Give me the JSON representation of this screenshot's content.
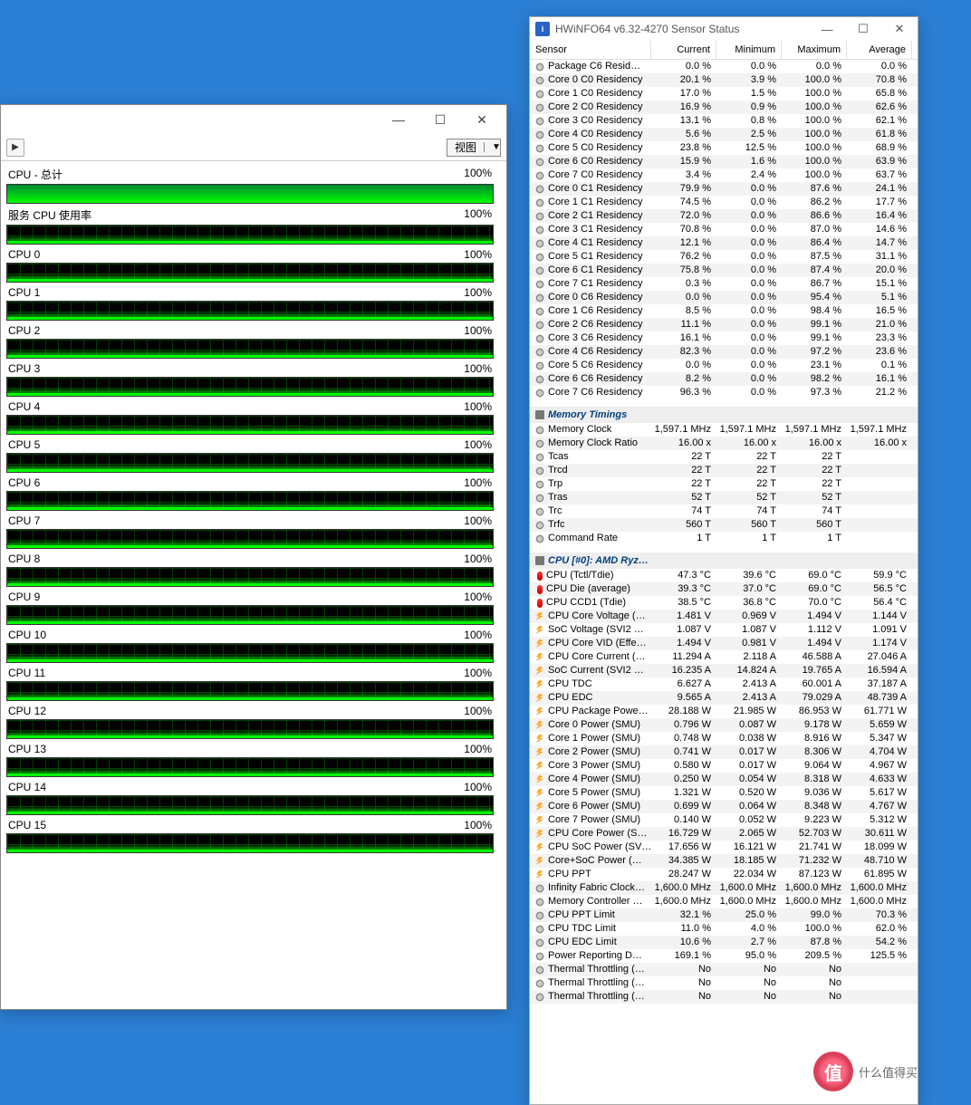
{
  "cpu_window": {
    "view_label": "视图",
    "min_btn": "—",
    "max_btn": "☐",
    "close_btn": "✕",
    "rows": [
      {
        "label": "CPU - 总计",
        "pct": "100%",
        "full": true
      },
      {
        "label": "服务 CPU 使用率",
        "pct": "100%",
        "full": false
      },
      {
        "label": "CPU 0",
        "pct": "100%",
        "full": false
      },
      {
        "label": "CPU 1",
        "pct": "100%",
        "full": false
      },
      {
        "label": "CPU 2",
        "pct": "100%",
        "full": false
      },
      {
        "label": "CPU 3",
        "pct": "100%",
        "full": false
      },
      {
        "label": "CPU 4",
        "pct": "100%",
        "full": false
      },
      {
        "label": "CPU 5",
        "pct": "100%",
        "full": false
      },
      {
        "label": "CPU 6",
        "pct": "100%",
        "full": false
      },
      {
        "label": "CPU 7",
        "pct": "100%",
        "full": false
      },
      {
        "label": "CPU 8",
        "pct": "100%",
        "full": false
      },
      {
        "label": "CPU 9",
        "pct": "100%",
        "full": false
      },
      {
        "label": "CPU 10",
        "pct": "100%",
        "full": false
      },
      {
        "label": "CPU 11",
        "pct": "100%",
        "full": false
      },
      {
        "label": "CPU 12",
        "pct": "100%",
        "full": false
      },
      {
        "label": "CPU 13",
        "pct": "100%",
        "full": false
      },
      {
        "label": "CPU 14",
        "pct": "100%",
        "full": false
      },
      {
        "label": "CPU 15",
        "pct": "100%",
        "full": false
      }
    ]
  },
  "hwinfo": {
    "title": "HWiNFO64 v6.32-4270 Sensor Status",
    "min_btn": "—",
    "max_btn": "☐",
    "close_btn": "✕",
    "columns": {
      "sensor": "Sensor",
      "cur": "Current",
      "min": "Minimum",
      "max": "Maximum",
      "avg": "Average"
    },
    "sections": [
      {
        "title": null,
        "rows": [
          {
            "ico": "clock",
            "name": "Package C6 Resid…",
            "cur": "0.0 %",
            "min": "0.0 %",
            "max": "0.0 %",
            "avg": "0.0 %"
          },
          {
            "ico": "clock",
            "name": "Core 0 C0 Residency",
            "cur": "20.1 %",
            "min": "3.9 %",
            "max": "100.0 %",
            "avg": "70.8 %"
          },
          {
            "ico": "clock",
            "name": "Core 1 C0 Residency",
            "cur": "17.0 %",
            "min": "1.5 %",
            "max": "100.0 %",
            "avg": "65.8 %"
          },
          {
            "ico": "clock",
            "name": "Core 2 C0 Residency",
            "cur": "16.9 %",
            "min": "0.9 %",
            "max": "100.0 %",
            "avg": "62.6 %"
          },
          {
            "ico": "clock",
            "name": "Core 3 C0 Residency",
            "cur": "13.1 %",
            "min": "0.8 %",
            "max": "100.0 %",
            "avg": "62.1 %"
          },
          {
            "ico": "clock",
            "name": "Core 4 C0 Residency",
            "cur": "5.6 %",
            "min": "2.5 %",
            "max": "100.0 %",
            "avg": "61.8 %"
          },
          {
            "ico": "clock",
            "name": "Core 5 C0 Residency",
            "cur": "23.8 %",
            "min": "12.5 %",
            "max": "100.0 %",
            "avg": "68.9 %"
          },
          {
            "ico": "clock",
            "name": "Core 6 C0 Residency",
            "cur": "15.9 %",
            "min": "1.6 %",
            "max": "100.0 %",
            "avg": "63.9 %"
          },
          {
            "ico": "clock",
            "name": "Core 7 C0 Residency",
            "cur": "3.4 %",
            "min": "2.4 %",
            "max": "100.0 %",
            "avg": "63.7 %"
          },
          {
            "ico": "clock",
            "name": "Core 0 C1 Residency",
            "cur": "79.9 %",
            "min": "0.0 %",
            "max": "87.6 %",
            "avg": "24.1 %"
          },
          {
            "ico": "clock",
            "name": "Core 1 C1 Residency",
            "cur": "74.5 %",
            "min": "0.0 %",
            "max": "86.2 %",
            "avg": "17.7 %"
          },
          {
            "ico": "clock",
            "name": "Core 2 C1 Residency",
            "cur": "72.0 %",
            "min": "0.0 %",
            "max": "86.6 %",
            "avg": "16.4 %"
          },
          {
            "ico": "clock",
            "name": "Core 3 C1 Residency",
            "cur": "70.8 %",
            "min": "0.0 %",
            "max": "87.0 %",
            "avg": "14.6 %"
          },
          {
            "ico": "clock",
            "name": "Core 4 C1 Residency",
            "cur": "12.1 %",
            "min": "0.0 %",
            "max": "86.4 %",
            "avg": "14.7 %"
          },
          {
            "ico": "clock",
            "name": "Core 5 C1 Residency",
            "cur": "76.2 %",
            "min": "0.0 %",
            "max": "87.5 %",
            "avg": "31.1 %"
          },
          {
            "ico": "clock",
            "name": "Core 6 C1 Residency",
            "cur": "75.8 %",
            "min": "0.0 %",
            "max": "87.4 %",
            "avg": "20.0 %"
          },
          {
            "ico": "clock",
            "name": "Core 7 C1 Residency",
            "cur": "0.3 %",
            "min": "0.0 %",
            "max": "86.7 %",
            "avg": "15.1 %"
          },
          {
            "ico": "clock",
            "name": "Core 0 C6 Residency",
            "cur": "0.0 %",
            "min": "0.0 %",
            "max": "95.4 %",
            "avg": "5.1 %"
          },
          {
            "ico": "clock",
            "name": "Core 1 C6 Residency",
            "cur": "8.5 %",
            "min": "0.0 %",
            "max": "98.4 %",
            "avg": "16.5 %"
          },
          {
            "ico": "clock",
            "name": "Core 2 C6 Residency",
            "cur": "11.1 %",
            "min": "0.0 %",
            "max": "99.1 %",
            "avg": "21.0 %"
          },
          {
            "ico": "clock",
            "name": "Core 3 C6 Residency",
            "cur": "16.1 %",
            "min": "0.0 %",
            "max": "99.1 %",
            "avg": "23.3 %"
          },
          {
            "ico": "clock",
            "name": "Core 4 C6 Residency",
            "cur": "82.3 %",
            "min": "0.0 %",
            "max": "97.2 %",
            "avg": "23.6 %"
          },
          {
            "ico": "clock",
            "name": "Core 5 C6 Residency",
            "cur": "0.0 %",
            "min": "0.0 %",
            "max": "23.1 %",
            "avg": "0.1 %"
          },
          {
            "ico": "clock",
            "name": "Core 6 C6 Residency",
            "cur": "8.2 %",
            "min": "0.0 %",
            "max": "98.2 %",
            "avg": "16.1 %"
          },
          {
            "ico": "clock",
            "name": "Core 7 C6 Residency",
            "cur": "96.3 %",
            "min": "0.0 %",
            "max": "97.3 %",
            "avg": "21.2 %"
          }
        ]
      },
      {
        "title": "Memory Timings",
        "rows": [
          {
            "ico": "clock",
            "name": "Memory Clock",
            "cur": "1,597.1 MHz",
            "min": "1,597.1 MHz",
            "max": "1,597.1 MHz",
            "avg": "1,597.1 MHz"
          },
          {
            "ico": "clock",
            "name": "Memory Clock Ratio",
            "cur": "16.00 x",
            "min": "16.00 x",
            "max": "16.00 x",
            "avg": "16.00 x"
          },
          {
            "ico": "clock",
            "name": "Tcas",
            "cur": "22 T",
            "min": "22 T",
            "max": "22 T",
            "avg": ""
          },
          {
            "ico": "clock",
            "name": "Trcd",
            "cur": "22 T",
            "min": "22 T",
            "max": "22 T",
            "avg": ""
          },
          {
            "ico": "clock",
            "name": "Trp",
            "cur": "22 T",
            "min": "22 T",
            "max": "22 T",
            "avg": ""
          },
          {
            "ico": "clock",
            "name": "Tras",
            "cur": "52 T",
            "min": "52 T",
            "max": "52 T",
            "avg": ""
          },
          {
            "ico": "clock",
            "name": "Trc",
            "cur": "74 T",
            "min": "74 T",
            "max": "74 T",
            "avg": ""
          },
          {
            "ico": "clock",
            "name": "Trfc",
            "cur": "560 T",
            "min": "560 T",
            "max": "560 T",
            "avg": ""
          },
          {
            "ico": "clock",
            "name": "Command Rate",
            "cur": "1 T",
            "min": "1 T",
            "max": "1 T",
            "avg": ""
          }
        ]
      },
      {
        "title": "CPU [#0]: AMD Ryz…",
        "rows": [
          {
            "ico": "temp",
            "name": "CPU (Tctl/Tdie)",
            "cur": "47.3 °C",
            "min": "39.6 °C",
            "max": "69.0 °C",
            "avg": "59.9 °C"
          },
          {
            "ico": "temp",
            "name": "CPU Die (average)",
            "cur": "39.3 °C",
            "min": "37.0 °C",
            "max": "69.0 °C",
            "avg": "56.5 °C"
          },
          {
            "ico": "temp",
            "name": "CPU CCD1 (Tdie)",
            "cur": "38.5 °C",
            "min": "36.8 °C",
            "max": "70.0 °C",
            "avg": "56.4 °C"
          },
          {
            "ico": "bolt",
            "name": "CPU Core Voltage (…",
            "cur": "1.481 V",
            "min": "0.969 V",
            "max": "1.494 V",
            "avg": "1.144 V"
          },
          {
            "ico": "bolt",
            "name": "SoC Voltage (SVI2 …",
            "cur": "1.087 V",
            "min": "1.087 V",
            "max": "1.112 V",
            "avg": "1.091 V"
          },
          {
            "ico": "bolt",
            "name": "CPU Core VID (Effe…",
            "cur": "1.494 V",
            "min": "0.981 V",
            "max": "1.494 V",
            "avg": "1.174 V"
          },
          {
            "ico": "bolt",
            "name": "CPU Core Current (…",
            "cur": "11.294 A",
            "min": "2.118 A",
            "max": "46.588 A",
            "avg": "27.046 A"
          },
          {
            "ico": "bolt",
            "name": "SoC Current (SVI2 …",
            "cur": "16.235 A",
            "min": "14.824 A",
            "max": "19.765 A",
            "avg": "16.594 A"
          },
          {
            "ico": "bolt",
            "name": "CPU TDC",
            "cur": "6.627 A",
            "min": "2.413 A",
            "max": "60.001 A",
            "avg": "37.187 A"
          },
          {
            "ico": "bolt",
            "name": "CPU EDC",
            "cur": "9.565 A",
            "min": "2.413 A",
            "max": "79.029 A",
            "avg": "48.739 A"
          },
          {
            "ico": "bolt",
            "name": "CPU Package Powe…",
            "cur": "28.188 W",
            "min": "21.985 W",
            "max": "86.953 W",
            "avg": "61.771 W"
          },
          {
            "ico": "bolt",
            "name": "Core 0 Power (SMU)",
            "cur": "0.796 W",
            "min": "0.087 W",
            "max": "9.178 W",
            "avg": "5.659 W"
          },
          {
            "ico": "bolt",
            "name": "Core 1 Power (SMU)",
            "cur": "0.748 W",
            "min": "0.038 W",
            "max": "8.916 W",
            "avg": "5.347 W"
          },
          {
            "ico": "bolt",
            "name": "Core 2 Power (SMU)",
            "cur": "0.741 W",
            "min": "0.017 W",
            "max": "8.306 W",
            "avg": "4.704 W"
          },
          {
            "ico": "bolt",
            "name": "Core 3 Power (SMU)",
            "cur": "0.580 W",
            "min": "0.017 W",
            "max": "9.064 W",
            "avg": "4.967 W"
          },
          {
            "ico": "bolt",
            "name": "Core 4 Power (SMU)",
            "cur": "0.250 W",
            "min": "0.054 W",
            "max": "8.318 W",
            "avg": "4.633 W"
          },
          {
            "ico": "bolt",
            "name": "Core 5 Power (SMU)",
            "cur": "1.321 W",
            "min": "0.520 W",
            "max": "9.036 W",
            "avg": "5.617 W"
          },
          {
            "ico": "bolt",
            "name": "Core 6 Power (SMU)",
            "cur": "0.699 W",
            "min": "0.064 W",
            "max": "8.348 W",
            "avg": "4.767 W"
          },
          {
            "ico": "bolt",
            "name": "Core 7 Power (SMU)",
            "cur": "0.140 W",
            "min": "0.052 W",
            "max": "9.223 W",
            "avg": "5.312 W"
          },
          {
            "ico": "bolt",
            "name": "CPU Core Power (S…",
            "cur": "16.729 W",
            "min": "2.065 W",
            "max": "52.703 W",
            "avg": "30.611 W"
          },
          {
            "ico": "bolt",
            "name": "CPU SoC Power (SV…",
            "cur": "17.656 W",
            "min": "16.121 W",
            "max": "21.741 W",
            "avg": "18.099 W"
          },
          {
            "ico": "bolt",
            "name": "Core+SoC Power (…",
            "cur": "34.385 W",
            "min": "18.185 W",
            "max": "71.232 W",
            "avg": "48.710 W"
          },
          {
            "ico": "bolt",
            "name": "CPU PPT",
            "cur": "28.247 W",
            "min": "22.034 W",
            "max": "87.123 W",
            "avg": "61.895 W"
          },
          {
            "ico": "clock",
            "name": "Infinity Fabric Clock…",
            "cur": "1,600.0 MHz",
            "min": "1,600.0 MHz",
            "max": "1,600.0 MHz",
            "avg": "1,600.0 MHz"
          },
          {
            "ico": "clock",
            "name": "Memory Controller …",
            "cur": "1,600.0 MHz",
            "min": "1,600.0 MHz",
            "max": "1,600.0 MHz",
            "avg": "1,600.0 MHz"
          },
          {
            "ico": "clock",
            "name": "CPU PPT Limit",
            "cur": "32.1 %",
            "min": "25.0 %",
            "max": "99.0 %",
            "avg": "70.3 %"
          },
          {
            "ico": "clock",
            "name": "CPU TDC Limit",
            "cur": "11.0 %",
            "min": "4.0 %",
            "max": "100.0 %",
            "avg": "62.0 %"
          },
          {
            "ico": "clock",
            "name": "CPU EDC Limit",
            "cur": "10.6 %",
            "min": "2.7 %",
            "max": "87.8 %",
            "avg": "54.2 %"
          },
          {
            "ico": "clock",
            "name": "Power Reporting D…",
            "cur": "169.1 %",
            "min": "95.0 %",
            "max": "209.5 %",
            "avg": "125.5 %"
          },
          {
            "ico": "clock",
            "name": "Thermal Throttling (…",
            "cur": "No",
            "min": "No",
            "max": "No",
            "avg": ""
          },
          {
            "ico": "clock",
            "name": "Thermal Throttling (…",
            "cur": "No",
            "min": "No",
            "max": "No",
            "avg": ""
          },
          {
            "ico": "clock",
            "name": "Thermal Throttling (…",
            "cur": "No",
            "min": "No",
            "max": "No",
            "avg": ""
          }
        ]
      }
    ]
  },
  "watermark": {
    "brand": "值",
    "text": "什么值得买"
  }
}
